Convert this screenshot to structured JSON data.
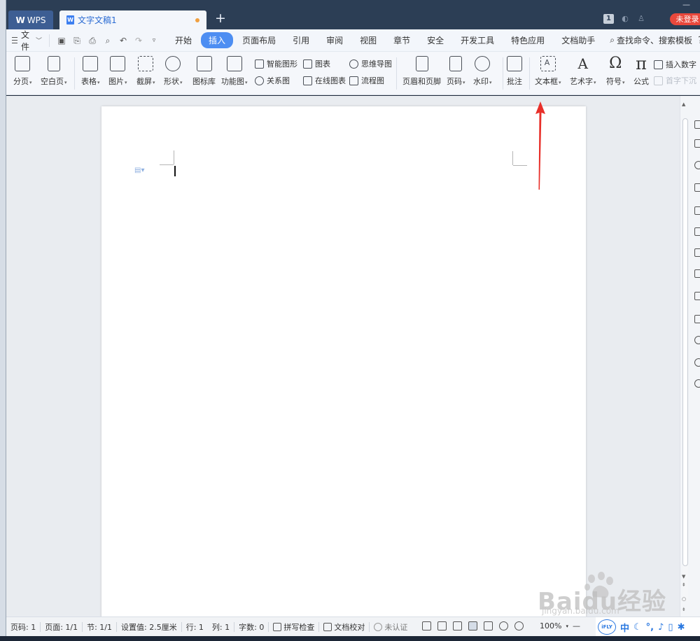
{
  "titlebar": {
    "app_tab": "WPS",
    "doc_tab": "文字文稿1",
    "doc_icon": "W",
    "add_tab": "+",
    "count_badge": "1",
    "login_label": "未登录"
  },
  "menubar": {
    "file_label": "文件",
    "tabs": [
      "开始",
      "插入",
      "页面布局",
      "引用",
      "审阅",
      "视图",
      "章节",
      "安全",
      "开发工具",
      "特色应用",
      "文档助手"
    ],
    "active_tab": "插入",
    "search_label": "查找命令、搜索模板",
    "help": "?",
    "more": "⋮",
    "collapse": "^"
  },
  "ribbon": {
    "page_break": "分页",
    "blank_page": "空白页",
    "table": "表格",
    "picture": "图片",
    "screenshot": "截屏",
    "shape": "形状",
    "icon_lib": "图标库",
    "func_chart": "功能图",
    "smart_shape": "智能图形",
    "chart": "图表",
    "mindmap": "思维导图",
    "relation": "关系图",
    "online_chart": "在线图表",
    "flowchart": "流程图",
    "header_footer": "页眉和页脚",
    "page_num": "页码",
    "watermark": "水印",
    "comment": "批注",
    "textbox": "文本框",
    "wordart": "艺术字",
    "symbol": "符号",
    "formula": "公式",
    "insert_number": "插入数字",
    "drop_cap": "首字下沉"
  },
  "statusbar": {
    "page_code": "页码: 1",
    "pages": "页面: 1/1",
    "section": "节: 1/1",
    "setting": "设置值: 2.5厘米",
    "line": "行: 1",
    "column": "列: 1",
    "words": "字数: 0",
    "spellcheck": "拼写检查",
    "proofread": "文档校对",
    "certify": "未认证",
    "zoom": "100%",
    "ifly": "iFLY",
    "ifly_cn": "中"
  },
  "watermark": {
    "brand": "Baidu经验",
    "url": "jingyan.baidu.com"
  },
  "colors": {
    "accent": "#4d8ef2",
    "titlebar": "#2c3e55",
    "login": "#e9483c",
    "arrow": "#e8302a"
  }
}
